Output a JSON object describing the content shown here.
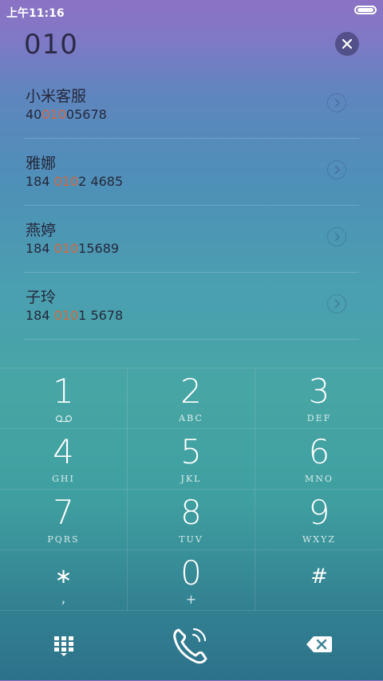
{
  "status": {
    "time": "上午11:16"
  },
  "dialer": {
    "input": "010"
  },
  "contacts": [
    {
      "name": "小米客服",
      "number_before": "40",
      "number_match": "010",
      "number_after": "05678"
    },
    {
      "name": "雅娜",
      "number_before": "184 ",
      "number_match": "010",
      "number_after": "2 4685"
    },
    {
      "name": "燕婷",
      "number_before": "184 ",
      "number_match": "010",
      "number_after": "15689"
    },
    {
      "name": "子玲",
      "number_before": "184 ",
      "number_match": "010",
      "number_after": "1 5678"
    }
  ],
  "keypad": {
    "k1": {
      "digit": "1"
    },
    "k2": {
      "digit": "2",
      "letters": "ABC"
    },
    "k3": {
      "digit": "3",
      "letters": "DEF"
    },
    "k4": {
      "digit": "4",
      "letters": "GHI"
    },
    "k5": {
      "digit": "5",
      "letters": "JKL"
    },
    "k6": {
      "digit": "6",
      "letters": "MNO"
    },
    "k7": {
      "digit": "7",
      "letters": "PQRS"
    },
    "k8": {
      "digit": "8",
      "letters": "TUV"
    },
    "k9": {
      "digit": "9",
      "letters": "WXYZ"
    },
    "kstar": {
      "symbol": "∗",
      "sub": ","
    },
    "k0": {
      "digit": "0",
      "sub": "+"
    },
    "khash": {
      "symbol": "#"
    }
  },
  "colors": {
    "highlight": "#d9663d",
    "text_dark": "#25283c",
    "key_text": "#ffffff"
  },
  "icons": {
    "clear": "close-icon",
    "detail": "chevron-right-icon",
    "keypad_toggle": "dialpad-grid-icon",
    "call": "phone-call-icon",
    "backspace": "backspace-icon",
    "voicemail": "voicemail-icon"
  }
}
